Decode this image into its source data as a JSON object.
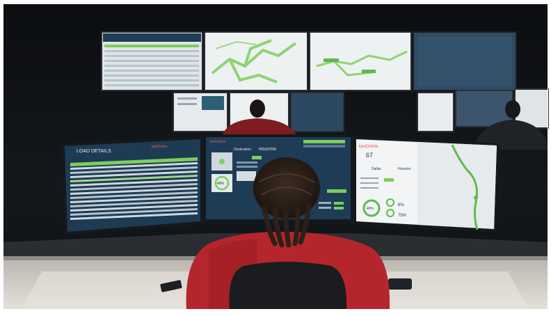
{
  "scene": {
    "left_monitor": {
      "title": "LOAD DETAILS",
      "brand": "kiwiOnline"
    },
    "center_monitor": {
      "brand": "kiwiOnline",
      "destination_label": "Destination",
      "destination_value": "HOUSTON",
      "progress_percent": "49%"
    },
    "right_monitor": {
      "brand": "kiwiOnline",
      "big_number": "67",
      "from_city": "Dallas",
      "to_city": "Houston",
      "gauge_main": "49%",
      "stat_a": "6%",
      "stat_b": "75%"
    }
  },
  "colors": {
    "room": "#101214",
    "screen_dark": "#1d3a52",
    "screen_light": "#e9eef2",
    "accent_green": "#7ccf5c",
    "shirt_red": "#b5262c",
    "desk": "#d9d5cf"
  }
}
